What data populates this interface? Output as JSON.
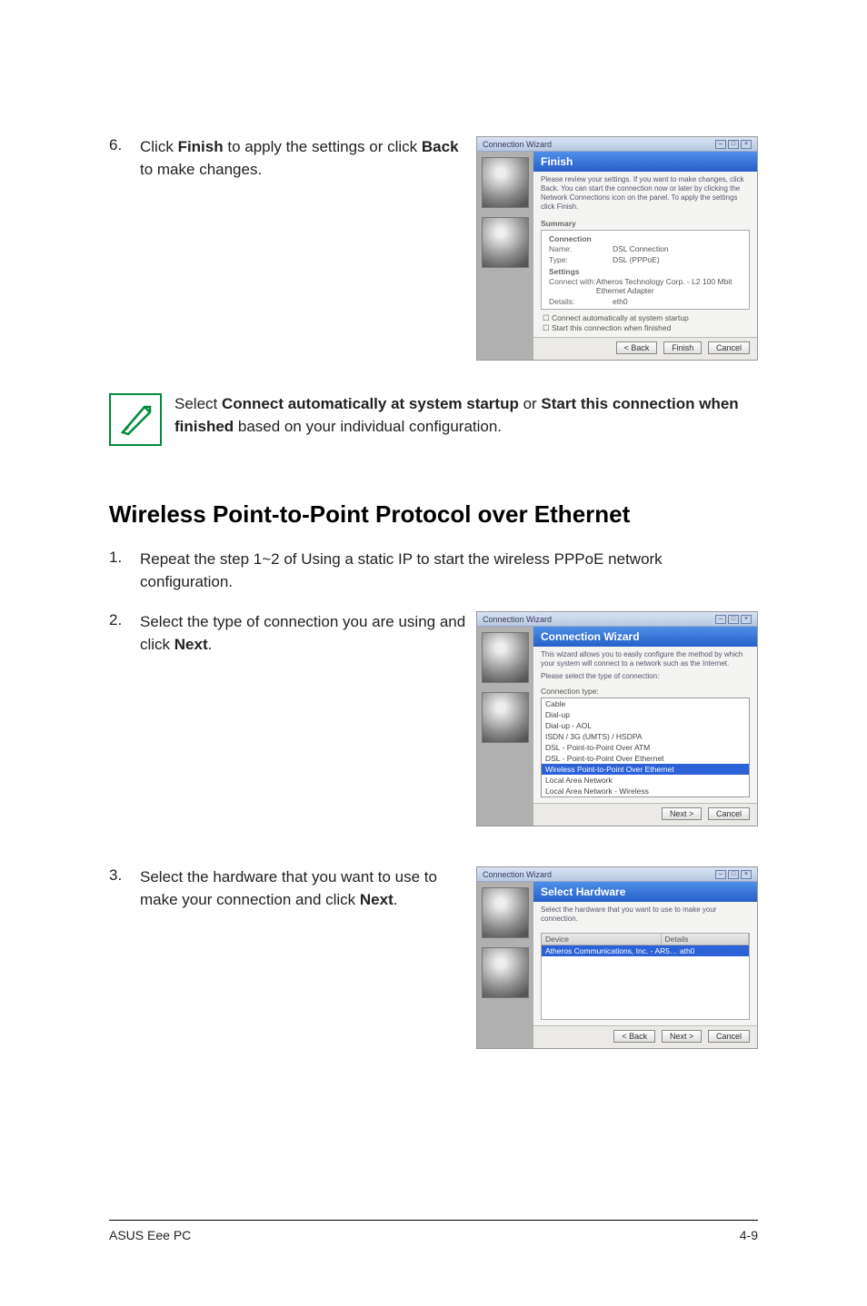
{
  "step6": {
    "num": "6.",
    "text_a": "Click ",
    "bold_a": "Finish",
    "text_b": " to apply the settings or click ",
    "bold_b": "Back",
    "text_c": " to make changes."
  },
  "note": {
    "text_a": "Select ",
    "bold_a": "Connect automatically at system startup",
    "text_b": " or ",
    "bold_b": "Start this connection when finished",
    "text_c": " based on your individual configuration."
  },
  "section_heading": "Wireless Point-to-Point Protocol over Ethernet",
  "step1": {
    "num": "1.",
    "text": "Repeat the step 1~2 of Using a static IP to start the wireless PPPoE network configuration."
  },
  "step2": {
    "num": "2.",
    "text_a": "Select the type of connection you are using and click ",
    "bold_a": "Next",
    "text_b": "."
  },
  "step3": {
    "num": "3.",
    "text_a": "Select the hardware that you want to use to make your connection and click ",
    "bold_a": "Next",
    "text_b": "."
  },
  "shot_finish": {
    "window_title": "Connection Wizard",
    "header": "Finish",
    "desc": "Please review your settings. If you want to make changes, click Back. You can start the connection now or later by clicking the Network Connections icon on the panel. To apply the settings click Finish.",
    "grp_summary": "Summary",
    "grp_connection": "Connection",
    "name_label": "Name:",
    "name_val": "DSL Connection",
    "type_label": "Type:",
    "type_val": "DSL (PPPoE)",
    "grp_settings": "Settings",
    "connectwith_label": "Connect with:",
    "connectwith_val": "Atheros Technology Corp. - L2 100 Mbit Ethernet Adapter",
    "details_label": "Details:",
    "details_val": "eth0",
    "check1": "Connect automatically at system startup",
    "check2": "Start this connection when finished",
    "btn_back": "< Back",
    "btn_finish": "Finish",
    "btn_cancel": "Cancel"
  },
  "shot_conn": {
    "window_title": "Connection Wizard",
    "header": "Connection Wizard",
    "desc1": "This wizard allows you to easily configure the method by which your system will connect to a network such as the Internet.",
    "desc2": "Please select the type of connection:",
    "label": "Connection type:",
    "opt_cable": "Cable",
    "opt_dialup": "Dial-up",
    "opt_dialup_aol": "Dial-up - AOL",
    "opt_isdn": "ISDN / 3G (UMTS) / HSDPA",
    "opt_dsl_atm": "DSL - Point-to-Point Over ATM",
    "opt_dsl_eth": "DSL - Point-to-Point Over Ethernet",
    "opt_wireless_ppp": "Wireless Point-to-Point Over Ethernet",
    "opt_lan": "Local Area Network",
    "opt_lan_wireless": "Local Area Network - Wireless",
    "btn_next": "Next >",
    "btn_cancel": "Cancel"
  },
  "shot_hw": {
    "window_title": "Connection Wizard",
    "header": "Select Hardware",
    "desc": "Select the hardware that you want to use to make your connection.",
    "col_device": "Device",
    "col_details": "Details",
    "row_device": "Atheros Communications, Inc. - AR5… ath0",
    "btn_back": "< Back",
    "btn_next": "Next >",
    "btn_cancel": "Cancel"
  },
  "footer": {
    "left": "ASUS Eee PC",
    "right": "4-9"
  },
  "win": {
    "min": "–",
    "max": "□",
    "close": "×"
  }
}
